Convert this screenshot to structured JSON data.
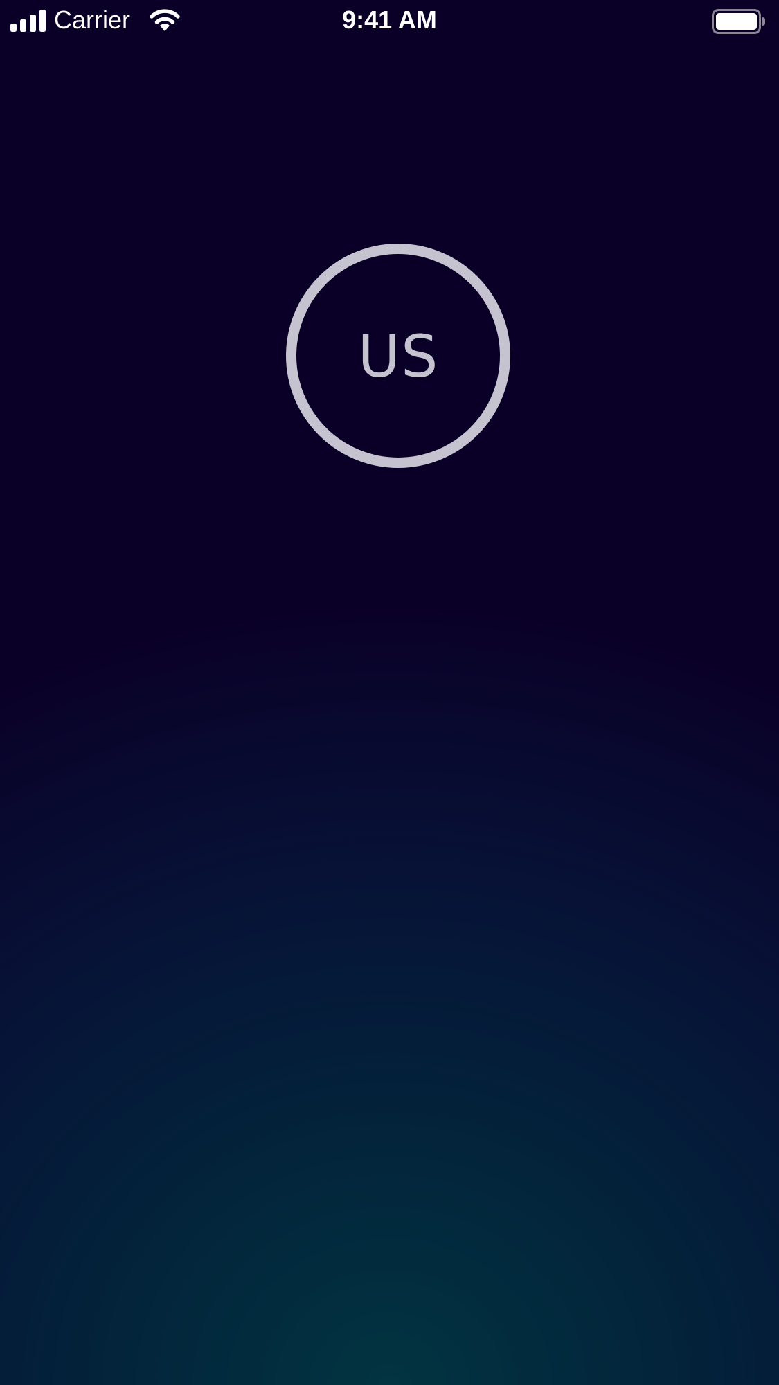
{
  "status_bar": {
    "carrier": "Carrier",
    "time": "9:41 AM",
    "signal_icon": "cellular-signal-icon",
    "wifi_icon": "wifi-icon",
    "battery_icon": "battery-icon"
  },
  "avatar": {
    "initials": "US"
  },
  "colors": {
    "background_top": "#0a0025",
    "background_bottom_glow": "#023441",
    "avatar_ring": "#c6c3d1",
    "status_text": "#ffffff"
  }
}
